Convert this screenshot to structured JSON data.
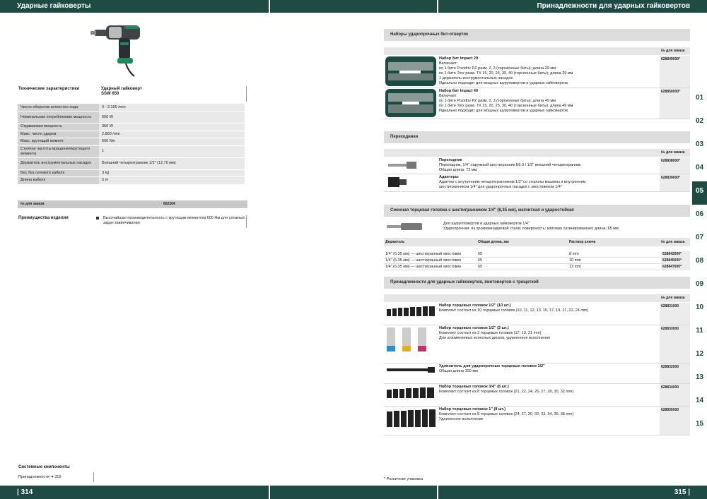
{
  "left_header": "Ударные гайковерты",
  "right_header": "Принадлежности для ударных гайковертов",
  "left_page": "| 314",
  "right_page": "315 |",
  "spec": {
    "label": "Технические характеристики",
    "product_line1": "Ударный гайковерт",
    "product_line2": "SSW 650",
    "rows": [
      {
        "k": "Число оборотов холостого хода",
        "v": "0 - 2.100 /min"
      },
      {
        "k": "Номинальная потребляемая мощность",
        "v": "650 W"
      },
      {
        "k": "Отдаваемая мощность",
        "v": "360 W"
      },
      {
        "k": "Макс. число ударов",
        "v": "2.800 /min"
      },
      {
        "k": "Макс. крутящий момент",
        "v": "600 Nm"
      },
      {
        "k": "Ступени частоты вращения/крутящего момента",
        "v": "1"
      },
      {
        "k": "Держатель инструментальных насадок",
        "v": "Внешний четырехгранник 1/2\" (12,70 мм)"
      },
      {
        "k": "Вес без сетевого кабеля",
        "v": "3 kg"
      },
      {
        "k": "Длина кабеля",
        "v": "5 m"
      }
    ],
    "order_label": "№ для заказа",
    "order_no": "602204"
  },
  "advantages": {
    "label": "Преимущества изделия",
    "text": "Высочайшая производительность с крутящим моментом 600 Нм для сложных задач завинчивания"
  },
  "system": {
    "title": "Системные компоненты",
    "link": "Принадлежности  ➔  315"
  },
  "footnote": "* Розничная упаковка",
  "order_col": "№ для заказа",
  "sections": {
    "bits": {
      "title": "Наборы ударопрочных бит-отверток",
      "items": [
        {
          "name": "Набор бит Impact 29",
          "desc": "Включает:\nпо 1 бите Pozidriv PZ разм. 2, 3 (торсионные биты); длина 29 мм\nпо 1 бите Torx разм. TX 15, 20, 25, 30, 40 (торсионные биты); длина 29 мм\n1 держатель инструментальных насадок\nИдеально подходит для мощных шуруповертов и ударных гайковертов",
          "order": "628849000*"
        },
        {
          "name": "Набор бит Impact 49",
          "desc": "Включает:\nпо 1 бите Pozidriv PZ разм. 2, 3 (торсионные биты); длина 49 мм\nпо 1 бите Torx разм. TX 15, 20, 25, 30, 40 (торсионные биты); длина 49 мм\nИдеально подходит для мощных шуруповертов и ударных гайковертов",
          "order": "628850000*"
        }
      ]
    },
    "adapters": {
      "title": "Переходники",
      "items": [
        {
          "name": "Переходник",
          "desc": "Переходник, 1/4\" наружный шестигранник E6.3 / 1/2\" внешний четырехгранник\nОбщая длина: 72 мм",
          "order": "628838000*"
        },
        {
          "name": "Адаптеры",
          "desc": "Адаптер с внутренним четырехгранником 1/2\" со стороны машины и внутренним\nшестигранником 1/4\" для ударопрочных насадок с хвостовиком 1/4\"",
          "order": "628839000*"
        }
      ]
    },
    "socket": {
      "title": "Сменная торцевая головка с шестигранником 1/4\" (6,35 мм), магнитная и ударостойкая",
      "intro": "Для шурупповертов и ударных гайковертов 1/4\"\nУдаропрочная: из хромованадиевой стали; поверхность: матовая сатинированная; длина: 65 мм",
      "headers": [
        "Держатель",
        "Общая длина, мм",
        "Раствор ключа",
        "№ для заказа"
      ],
      "rows": [
        [
          "1/4\" (6,35 мм) — шестигранный хвостовик",
          "65",
          "8 mm",
          "628842000*"
        ],
        [
          "1/4\" (6,35 мм) — шестигранный хвостовик",
          "65",
          "10 mm",
          "628845000*"
        ],
        [
          "1/4\" (6,35 мм) — шестигранный хвостовик",
          "65",
          "13 mm",
          "628847000*"
        ]
      ]
    },
    "impact": {
      "title": "Принадлежности для ударных гайковертов, винтовертов с трещоткой",
      "items": [
        {
          "name": "Набор торцевых головок 1/2\" (10 шт.)",
          "desc": "Комплект состоит из 10 торцевых головок (10, 11, 12, 13, 15, 17, 19, 21, 22, 24 mm)",
          "order": "628831000"
        },
        {
          "name": "Набор торцевых головок 1/2\" (3 шт.)",
          "desc": "Комплект состоит из 3 торцевых головок (17, 19, 21 mm)\nДля алюминиевых колесных дисков, удлиненное исполнение",
          "order": "628833000"
        },
        {
          "name": "Удлинитель для ударопрочных торцевых головок 1/2\"",
          "desc": "Общая длина 150 мм",
          "order": "628832000"
        },
        {
          "name": "Набор торцевых головок 3/4\" (8 шт.)",
          "desc": "Комплект состоит из 8 торцевых головок (21, 22, 24, 26, 27, 28, 30, 32 mm)",
          "order": "628834000"
        },
        {
          "name": "Набор торцевых головок 1\" (8 шт.)",
          "desc": "Комплект состоит из 8 торцевых головок (24, 27, 30, 32, 33, 34, 36, 38 mm)\nУдлиненное исполнение",
          "order": "628835000"
        }
      ]
    }
  },
  "tabs": [
    "01",
    "02",
    "03",
    "04",
    "05",
    "06",
    "07",
    "08",
    "09",
    "10",
    "11",
    "12",
    "13",
    "14",
    "15"
  ],
  "active_tab": "05",
  "colors": {
    "brand": "#1d4a42",
    "accent_green": "#8dc63f",
    "header_gray": "#dcdcdc"
  }
}
